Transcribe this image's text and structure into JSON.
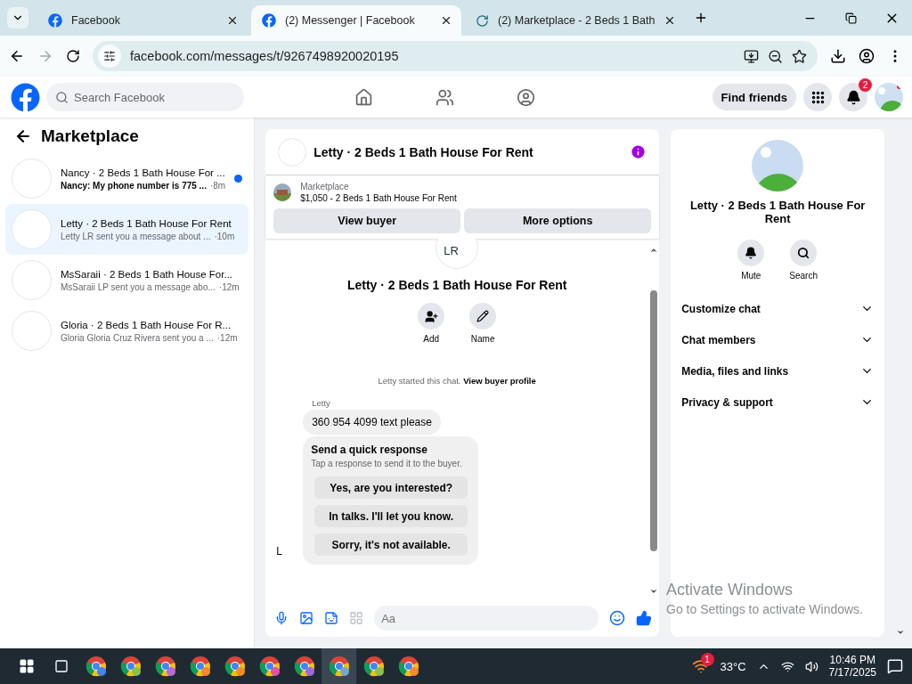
{
  "browser": {
    "tabs": [
      {
        "title": "Facebook",
        "selected": false,
        "kind": "facebook"
      },
      {
        "title": "(2) Messenger | Facebook",
        "selected": true,
        "kind": "facebook"
      },
      {
        "title": "(2) Marketplace - 2 Beds 1 Bath",
        "selected": false,
        "kind": "loading"
      }
    ],
    "url": "facebook.com/messages/t/9267498920020195"
  },
  "header": {
    "search_placeholder": "Search Facebook",
    "find_friends": "Find friends",
    "notification_count": "2"
  },
  "sidebar": {
    "title": "Marketplace",
    "conversations": [
      {
        "title": "Nancy · 2 Beds 1 Bath House For ...",
        "preview": "Nancy: My phone number is 775 ...",
        "time": "·8m",
        "unread": true,
        "selected": false
      },
      {
        "title": "Letty · 2 Beds 1 Bath House For Rent",
        "preview": "Letty LR sent you a message about ...",
        "time": "·10m",
        "unread": false,
        "selected": true
      },
      {
        "title": "MsSaraii · 2 Beds 1 Bath House For...",
        "preview": "MsSaraii LP sent you a message abo...",
        "time": "·12m",
        "unread": false,
        "selected": false
      },
      {
        "title": "Gloria · 2 Beds 1 Bath House For R...",
        "preview": "Gloria Gloria Cruz Rivera sent you a ...",
        "time": "·12m",
        "unread": false,
        "selected": false
      }
    ]
  },
  "chat": {
    "title": "Letty · 2 Beds 1 Bath House For Rent",
    "listing": {
      "label": "Marketplace",
      "name": "$1,050 - 2 Beds 1 Bath House For Rent"
    },
    "buttons": [
      "View buyer",
      "More options"
    ],
    "intro": {
      "avatar_alt": "LR",
      "title": "Letty · 2 Beds 1 Bath House For Rent",
      "actions": [
        {
          "label": "Add",
          "kind": "add"
        },
        {
          "label": "Name",
          "kind": "name"
        }
      ]
    },
    "started": {
      "text": "Letty started this chat.",
      "link": "View buyer profile"
    },
    "sender": "Letty",
    "message": "360 954 4099 text please",
    "quick_response": {
      "title": "Send a quick response",
      "subtitle": "Tap a response to send it to the buyer.",
      "options": [
        "Yes, are you interested?",
        "In talks. I'll let you know.",
        "Sorry, it's not available."
      ]
    },
    "avatar_alt": "L",
    "composer_placeholder": "Aa"
  },
  "info": {
    "title": "Letty · 2 Beds 1 Bath House For Rent",
    "actions": [
      {
        "label": "Mute",
        "kind": "bell"
      },
      {
        "label": "Search",
        "kind": "search"
      }
    ],
    "sections": [
      {
        "label": "Customize chat",
        "expanded": false
      },
      {
        "label": "Chat members",
        "expanded": false
      },
      {
        "label": "Media, files and links",
        "expanded": false
      },
      {
        "label": "Privacy & support",
        "expanded": false
      }
    ]
  },
  "activation": {
    "title": "Activate Windows",
    "subtitle": "Go to Settings to activate Windows."
  },
  "taskbar": {
    "weather_badge": "1",
    "temperature": "33°C",
    "time": "10:46 PM",
    "date": "7/17/2025"
  }
}
